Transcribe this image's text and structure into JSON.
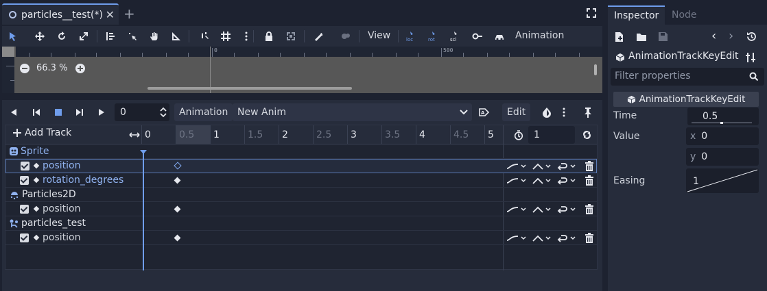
{
  "tab": {
    "title": "particles__test(*)"
  },
  "toolbar": {
    "view_label": "View",
    "animation_label": "Animation"
  },
  "viewport": {
    "zoom": "66.3 %",
    "ruler_0": "0",
    "ruler_500": "500"
  },
  "anim_controls": {
    "time_value": "0",
    "animation_label": "Animation",
    "anim_name": "New Anim",
    "edit_label": "Edit"
  },
  "timeline": {
    "add_track_label": "Add Track",
    "ticks": [
      "0",
      "0.5",
      "1",
      "1.5",
      "2",
      "2.5",
      "3",
      "3.5",
      "4",
      "4.5",
      "5"
    ],
    "length_value": "1",
    "groups": [
      {
        "name": "Sprite",
        "tracks": [
          "position",
          "rotation_degrees"
        ]
      },
      {
        "name": "Particles2D",
        "tracks": [
          "position"
        ]
      },
      {
        "name": "particles_test",
        "tracks": [
          "position"
        ]
      }
    ]
  },
  "inspector": {
    "tab_inspector": "Inspector",
    "tab_node": "Node",
    "object_name": "AnimationTrackKeyEdit",
    "filter_placeholder": "Filter properties",
    "section_title": "AnimationTrackKeyEdit",
    "time_label": "Time",
    "time_value": "0.5",
    "value_label": "Value",
    "x_label": "x",
    "x_value": "0",
    "y_label": "y",
    "y_value": "0",
    "easing_label": "Easing",
    "easing_value": "1"
  },
  "colors": {
    "accent": "#6f9dec",
    "bg": "#1d2230",
    "panel": "#262c3b"
  }
}
